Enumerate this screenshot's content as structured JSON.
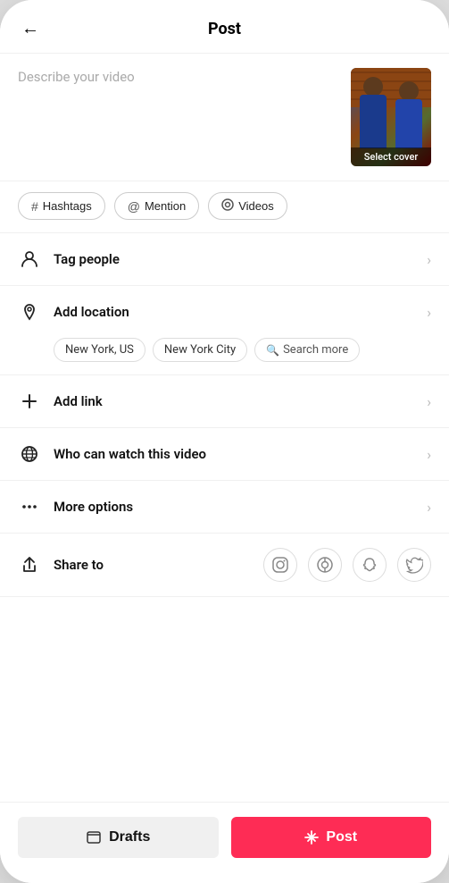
{
  "header": {
    "title": "Post",
    "back_label": "‹"
  },
  "describe": {
    "placeholder": "Describe your video"
  },
  "video": {
    "select_cover_label": "Select cover"
  },
  "tags": [
    {
      "id": "hashtags",
      "icon": "#",
      "label": "Hashtags"
    },
    {
      "id": "mention",
      "icon": "@",
      "label": "Mention"
    },
    {
      "id": "videos",
      "icon": "⊙",
      "label": "Videos"
    }
  ],
  "menu_items": [
    {
      "id": "tag-people",
      "icon": "person",
      "label": "Tag people",
      "has_chevron": true
    },
    {
      "id": "add-location",
      "icon": "location",
      "label": "Add location",
      "has_chevron": true
    },
    {
      "id": "add-link",
      "icon": "plus",
      "label": "Add link",
      "has_chevron": true
    },
    {
      "id": "who-can-watch",
      "icon": "globe",
      "label": "Who can watch this video",
      "has_chevron": true
    },
    {
      "id": "more-options",
      "icon": "dots",
      "label": "More options",
      "has_chevron": true
    }
  ],
  "location_tags": [
    {
      "id": "new-york-us",
      "label": "New York, US"
    },
    {
      "id": "new-york-city",
      "label": "New York City"
    },
    {
      "id": "search-more",
      "label": "Search more",
      "is_search": true
    }
  ],
  "share": {
    "label": "Share to",
    "platforms": [
      {
        "id": "instagram",
        "icon": "instagram"
      },
      {
        "id": "tiktok-now",
        "icon": "tiktok-now"
      },
      {
        "id": "snapchat",
        "icon": "snapchat"
      },
      {
        "id": "twitter",
        "icon": "twitter"
      }
    ]
  },
  "bottom": {
    "drafts_label": "Drafts",
    "post_label": "Post"
  }
}
